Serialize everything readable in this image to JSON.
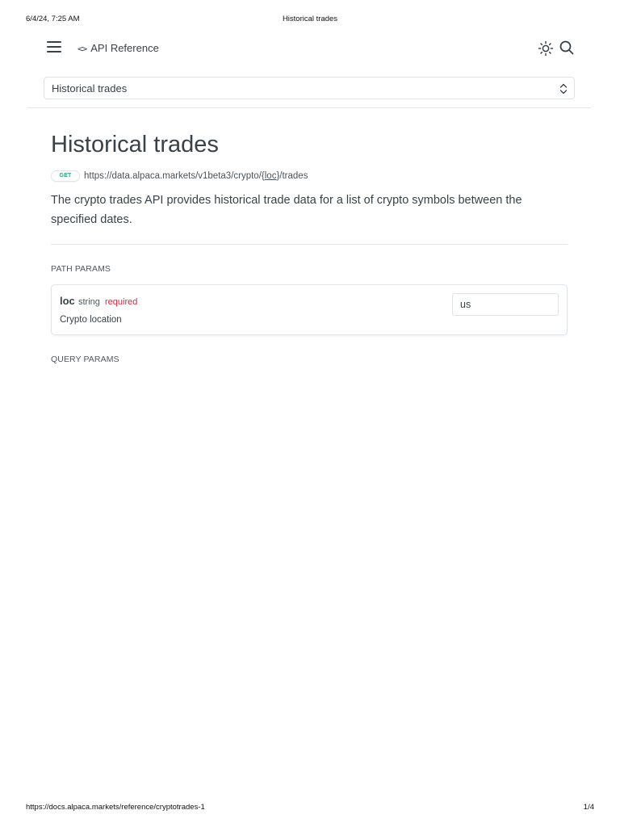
{
  "print_header": {
    "datetime": "6/4/24, 7:25 AM",
    "title": "Historical trades"
  },
  "nav": {
    "menu_icon": "hamburger-icon",
    "api_reference_icon": "code-brackets-icon",
    "api_reference_label": "API Reference",
    "theme_icon": "sun-icon",
    "search_icon": "search-icon"
  },
  "page_select": {
    "value": "Historical trades",
    "icon": "chevron-up-down-icon"
  },
  "endpoint": {
    "title": "Historical trades",
    "method": "GET",
    "url_prefix": "https://data.alpaca.markets/v1beta3/crypto/",
    "url_var_open": "{",
    "url_var": "loc",
    "url_var_close": "}",
    "url_suffix": "/trades",
    "description": "The crypto trades API provides historical trade data for a list of crypto symbols between the specified dates."
  },
  "path_params": {
    "label": "PATH PARAMS",
    "items": [
      {
        "name": "loc",
        "type": "string",
        "required_label": "required",
        "description": "Crypto location",
        "value": "us"
      }
    ]
  },
  "query_params": {
    "label": "QUERY PARAMS"
  },
  "print_footer": {
    "url": "https://docs.alpaca.markets/reference/cryptotrades-1",
    "page": "1/4"
  },
  "colors": {
    "method_get": "#31a57a",
    "required": "#e0243c",
    "text": "#384248",
    "border": "#dfe3e6"
  }
}
